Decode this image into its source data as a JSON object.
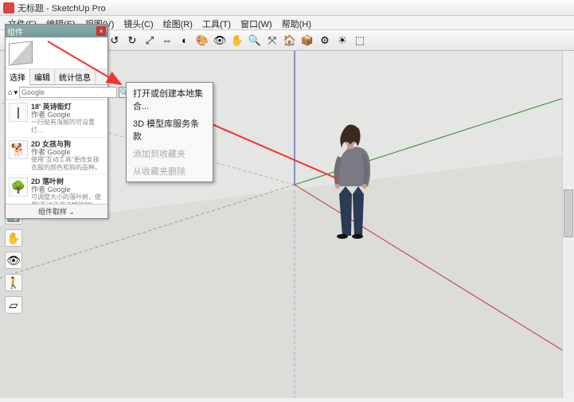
{
  "window": {
    "title": "无标题 - SketchUp Pro"
  },
  "menus": [
    "文件(F)",
    "编辑(E)",
    "视图(V)",
    "镜头(C)",
    "绘图(R)",
    "工具(T)",
    "窗口(W)",
    "帮助(H)"
  ],
  "toolbar_icons": [
    "select-icon",
    "eraser-icon",
    "pencil-icon",
    "rectangle-icon",
    "circle-icon",
    "arc-icon",
    "push-pull-icon",
    "move-icon",
    "rotate-icon",
    "scale-icon",
    "offset-icon",
    "tape-icon",
    "paint-icon",
    "orbit-icon",
    "pan-icon",
    "zoom-icon",
    "zoom-extents-icon",
    "warehouse-icon",
    "layers-icon",
    "shadows-icon",
    "tags-icon"
  ],
  "toolbar_glyphs": [
    "▭",
    "✎",
    "□",
    "○",
    "⌒",
    "⇆",
    "↺",
    "↻",
    "⤢",
    "⇔",
    "◐",
    "🎨",
    "👁",
    "✋",
    "🔍",
    "⤧",
    "🏠",
    "📦",
    "⚙",
    "☀",
    "⬚"
  ],
  "panel": {
    "title": "组件",
    "tabs": [
      "选择",
      "编辑",
      "统计信息"
    ],
    "search_placeholder": "Google",
    "home": "⌂",
    "items": [
      {
        "title": "18' 英诗街灯",
        "author": "作者 Google",
        "desc": "一行贴有海报的可设置灯…",
        "glyph": "|"
      },
      {
        "title": "2D 女孩与狗",
        "author": "作者 Google",
        "desc": "使用\"互动工具\"更改女孩衣服的颜色和狗的品种。",
        "glyph": "🐕"
      },
      {
        "title": "2D 落叶树",
        "author": "作者 Google",
        "desc": "可调整大小的落叶树，使用\"互动了很了解的树\"…",
        "glyph": "🌳"
      }
    ],
    "footer": "组件取样"
  },
  "context_menu": {
    "items": [
      {
        "label": "打开或创建本地集合...",
        "enabled": true
      },
      {
        "label": "3D 模型库服务条款",
        "enabled": true
      },
      {
        "label": "添加到收藏夹",
        "enabled": false
      },
      {
        "label": "从收藏夹删除",
        "enabled": false
      }
    ]
  },
  "rail_icons": [
    "orbit-icon",
    "pan-icon",
    "look-icon",
    "walk-icon",
    "section-icon"
  ],
  "rail_glyphs": [
    "🔄",
    "✋",
    "👁",
    "🚶",
    "▱"
  ]
}
